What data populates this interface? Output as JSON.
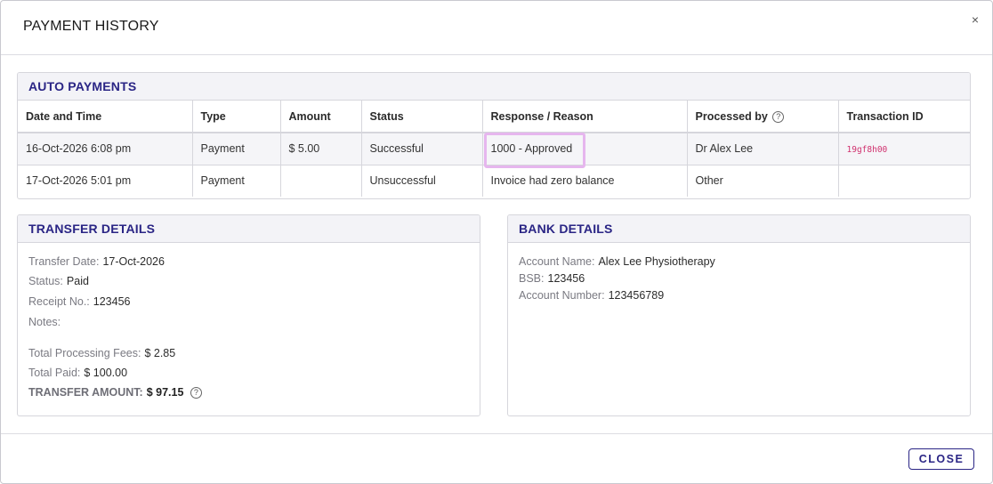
{
  "modal": {
    "title": "PAYMENT HISTORY",
    "close_x": "×",
    "close_button": "CLOSE"
  },
  "auto_payments": {
    "heading": "AUTO PAYMENTS",
    "columns": [
      "Date and Time",
      "Type",
      "Amount",
      "Status",
      "Response / Reason",
      "Processed by",
      "Transaction ID"
    ],
    "rows": [
      {
        "datetime": "16-Oct-2026 6:08 pm",
        "type": "Payment",
        "amount": "$ 5.00",
        "status": "Successful",
        "response": "1000 - Approved",
        "processed_by": "Dr Alex Lee",
        "transaction_id": "19gf8h00"
      },
      {
        "datetime": "17-Oct-2026 5:01 pm",
        "type": "Payment",
        "amount": "",
        "status": "Unsuccessful",
        "response": "Invoice had zero balance",
        "processed_by": "Other",
        "transaction_id": ""
      }
    ]
  },
  "transfer_details": {
    "heading": "TRANSFER DETAILS",
    "transfer_date_label": "Transfer Date:",
    "transfer_date": "17-Oct-2026",
    "status_label": "Status:",
    "status": "Paid",
    "receipt_label": "Receipt No.:",
    "receipt": "123456",
    "notes_label": "Notes:",
    "notes": "",
    "fees_label": "Total Processing Fees:",
    "fees": "$ 2.85",
    "paid_label": "Total Paid:",
    "paid": "$ 100.00",
    "transfer_amount_label": "TRANSFER AMOUNT:",
    "transfer_amount": "$ 97.15"
  },
  "bank_details": {
    "heading": "BANK DETAILS",
    "account_name_label": "Account Name:",
    "account_name": "Alex Lee Physiotherapy",
    "bsb_label": "BSB:",
    "bsb": "123456",
    "account_number_label": "Account Number:",
    "account_number": "123456789"
  },
  "icons": {
    "help": "?"
  },
  "colors": {
    "accent": "#2a2585",
    "highlight": "#e6b6ee",
    "transaction_id": "#d0306e"
  }
}
